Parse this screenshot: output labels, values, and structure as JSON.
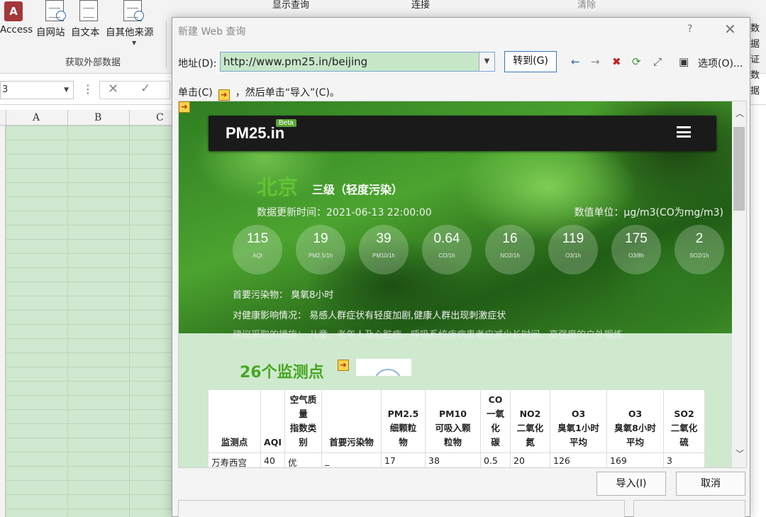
{
  "excel": {
    "ribbon_buttons": [
      "Access",
      "自网站",
      "自文本",
      "自其他来源"
    ],
    "group_label": "获取外部数据",
    "top_items": [
      "显示查询",
      "连接",
      "清除"
    ],
    "namebox": "3",
    "columns": [
      "A",
      "B",
      "C"
    ],
    "right_cut": [
      "数据",
      "证",
      "数据"
    ]
  },
  "dialog": {
    "title": "新建 Web 查询",
    "help": "?",
    "close": "✕",
    "address_label": "地址(D):",
    "address_value": "http://www.pm25.in/beijing",
    "goto_label": "转到(G)",
    "options_label": "选项(O)...",
    "hint_before": "单击(C)",
    "hint_after": "，然后单击“导入”(C)。",
    "import_label": "导入(I)",
    "cancel_label": "取消"
  },
  "web": {
    "brand": "PM25.in",
    "beta": "Beta",
    "city": "北京",
    "level": "三级（轻度污染）",
    "update_time": "数据更新时间：2021-06-13 22:00:00",
    "unit": "数值单位：μg/m3(CO为mg/m3)",
    "metrics": [
      {
        "value": "115",
        "label": "AQI"
      },
      {
        "value": "19",
        "label": "PM2.5/1h"
      },
      {
        "value": "39",
        "label": "PM10/1h"
      },
      {
        "value": "0.64",
        "label": "CO/1h"
      },
      {
        "value": "16",
        "label": "NO2/1h"
      },
      {
        "value": "119",
        "label": "O3/1h"
      },
      {
        "value": "175",
        "label": "O3/8h"
      },
      {
        "value": "2",
        "label": "SO2/1h"
      }
    ],
    "primary_pollutant": "首要污染物：  臭氧8小时",
    "health_effect": "对健康影响情况：  易感人群症状有轻度加剧,健康人群出现刺激症状",
    "advice": "建议采取的措施：  儿童、老年人及心脏病、呼吸系统疾病患者应减少长时间、高强度的户外锻炼",
    "stations_title": "26个监测点",
    "table": {
      "headers": [
        "监测点",
        "AQI",
        "空气质量指数类别",
        "首要污染物",
        "PM2.5 细颗粒物",
        "PM10 可吸入颗粒物",
        "CO 一氧化碳",
        "NO2 二氧化氮",
        "O3 臭氧1小时平均",
        "O3 臭氧8小时平均",
        "SO2 二氧化硫"
      ],
      "header_lines": [
        [
          "监测点"
        ],
        [
          "AQI"
        ],
        [
          "空气质",
          "量",
          "指数类",
          "别"
        ],
        [
          "首要污染物"
        ],
        [
          "PM2.5",
          "细颗粒",
          "物"
        ],
        [
          "PM10",
          "可吸入颗",
          "粒物"
        ],
        [
          "CO",
          "一氧化",
          "碳"
        ],
        [
          "NO2",
          "二氧化",
          "氮"
        ],
        [
          "O3",
          "臭氧1小时",
          "平均"
        ],
        [
          "O3",
          "臭氧8小时",
          "平均"
        ],
        [
          "SO2",
          "二氧化",
          "硫"
        ]
      ],
      "rows": [
        [
          "万寿西宫",
          "40",
          "优",
          "_",
          "17",
          "38",
          "0.5",
          "20",
          "126",
          "169",
          "3"
        ]
      ]
    }
  },
  "colors": {
    "city_green": "#63c331",
    "stations_green": "#45a81f",
    "address_bg": "#c7e7c9",
    "sheet_bg": "#cfe8cf"
  }
}
